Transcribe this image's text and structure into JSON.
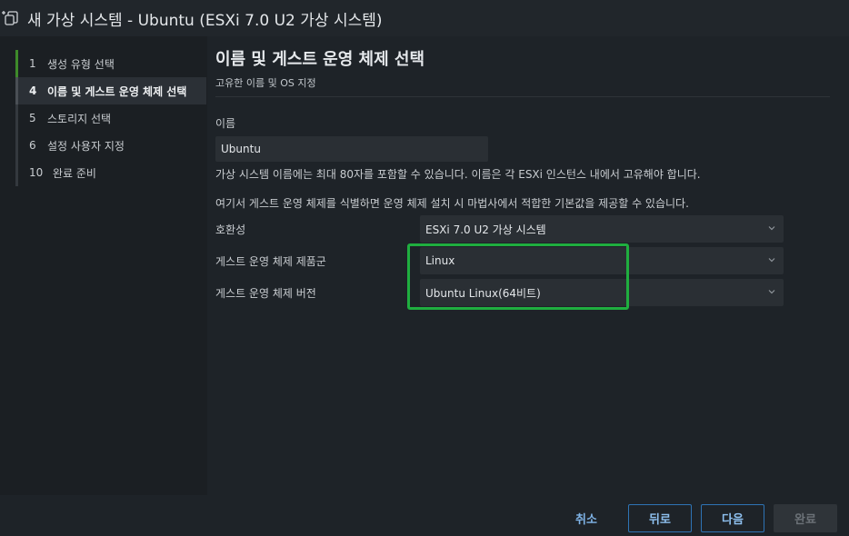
{
  "window": {
    "title": "새 가상 시스템 - Ubuntu (ESXi 7.0 U2 가상 시스템)"
  },
  "wizard_nav": {
    "items": [
      {
        "num": "1",
        "label": "생성 유형 선택"
      },
      {
        "num": "4",
        "label": "이름 및 게스트 운영 체제 선택"
      },
      {
        "num": "5",
        "label": "스토리지 선택"
      },
      {
        "num": "6",
        "label": "설정 사용자 지정"
      },
      {
        "num": "10",
        "label": "완료 준비"
      }
    ]
  },
  "main": {
    "title": "이름 및 게스트 운영 체제 선택",
    "subtitle": "고유한 이름 및 OS 지정",
    "name_label": "이름",
    "name_value": "Ubuntu",
    "name_help": "가상 시스템 이름에는 최대 80자를 포함할 수 있습니다. 이름은 각 ESXi 인스턴스 내에서 고유해야 합니다.",
    "os_help": "여기서 게스트 운영 체제를 식별하면 운영 체제 설치 시 마법사에서 적합한 기본값을 제공할 수 있습니다.",
    "compat_label": "호환성",
    "compat_value": "ESXi 7.0 U2 가상 시스템",
    "family_label": "게스트 운영 체제 제품군",
    "family_value": "Linux",
    "version_label": "게스트 운영 체제 버전",
    "version_value": "Ubuntu Linux(64비트)"
  },
  "footer": {
    "cancel": "취소",
    "back": "뒤로",
    "next": "다음",
    "finish": "완료"
  },
  "colors": {
    "highlight": "#1fae3f",
    "step_done": "#3e8a2a",
    "primary_button_border": "#2e74b5"
  }
}
